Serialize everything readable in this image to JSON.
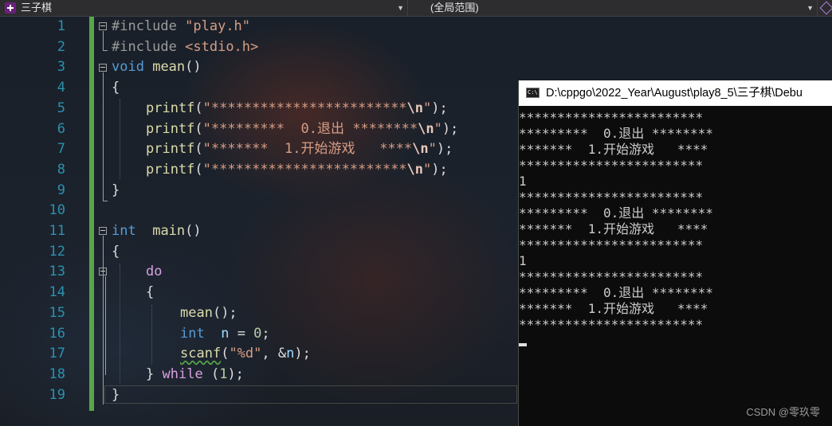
{
  "navbar": {
    "file_name": "三子棋",
    "scope": "(全局范围)"
  },
  "editor": {
    "line_numbers": [
      "1",
      "2",
      "3",
      "4",
      "5",
      "6",
      "7",
      "8",
      "9",
      "10",
      "11",
      "12",
      "13",
      "14",
      "15",
      "16",
      "17",
      "18",
      "19"
    ],
    "lines": [
      "#include \"play.h\"",
      "#include <stdio.h>",
      "void mean()",
      "{",
      "printf(\"************************\\n\");",
      "printf(\"*********  0.退出 ********\\n\");",
      "printf(\"*******  1.开始游戏   ****\\n\");",
      "printf(\"************************\\n\");",
      "}",
      "",
      "int  main()",
      "{",
      "do",
      "{",
      "mean();",
      "int  n = 0;",
      "scanf(\"%d\", &n);",
      "} while (1);",
      "}"
    ],
    "tokens": {
      "include1": "#include",
      "include1_file": "\"play.h\"",
      "include2": "#include",
      "include2_file": "<stdio.h>",
      "void": "void",
      "mean_fn": "mean",
      "parens": "()",
      "brace_open": "{",
      "brace_close": "}",
      "printf": "printf",
      "open_paren": "(",
      "close_semi": ");",
      "str5": "\"************************",
      "str6": "\"*********  0.退出 ********",
      "str7": "\"*******  1.开始游戏   ****",
      "str8": "\"************************",
      "esc_n": "\\n",
      "quote": "\"",
      "int": "int",
      "main_fn": "main",
      "do": "do",
      "mean_call": "mean",
      "call_semi": "();",
      "n_var": "n",
      "assign": " = ",
      "zero": "0",
      "semi": ";",
      "scanf": "scanf",
      "fmt": "\"%d\"",
      "comma": ", &",
      "while": "while",
      "one": "1",
      "while_close": ");"
    }
  },
  "console": {
    "title": "D:\\cppgo\\2022_Year\\August\\play8_5\\三子棋\\Debu",
    "icon_text": "C:\\",
    "lines": [
      "************************",
      "*********  0.退出 ********",
      "*******  1.开始游戏   ****",
      "************************",
      "1",
      "************************",
      "*********  0.退出 ********",
      "*******  1.开始游戏   ****",
      "************************",
      "1",
      "************************",
      "*********  0.退出 ********",
      "*******  1.开始游戏   ****",
      "************************"
    ]
  },
  "watermark": "CSDN @零玖零",
  "colors": {
    "keyword": "#569cd6",
    "control": "#d8a0df",
    "function": "#dcdcaa",
    "string": "#d69d85",
    "line_number": "#2b91af",
    "change_bar": "#57a64a"
  }
}
